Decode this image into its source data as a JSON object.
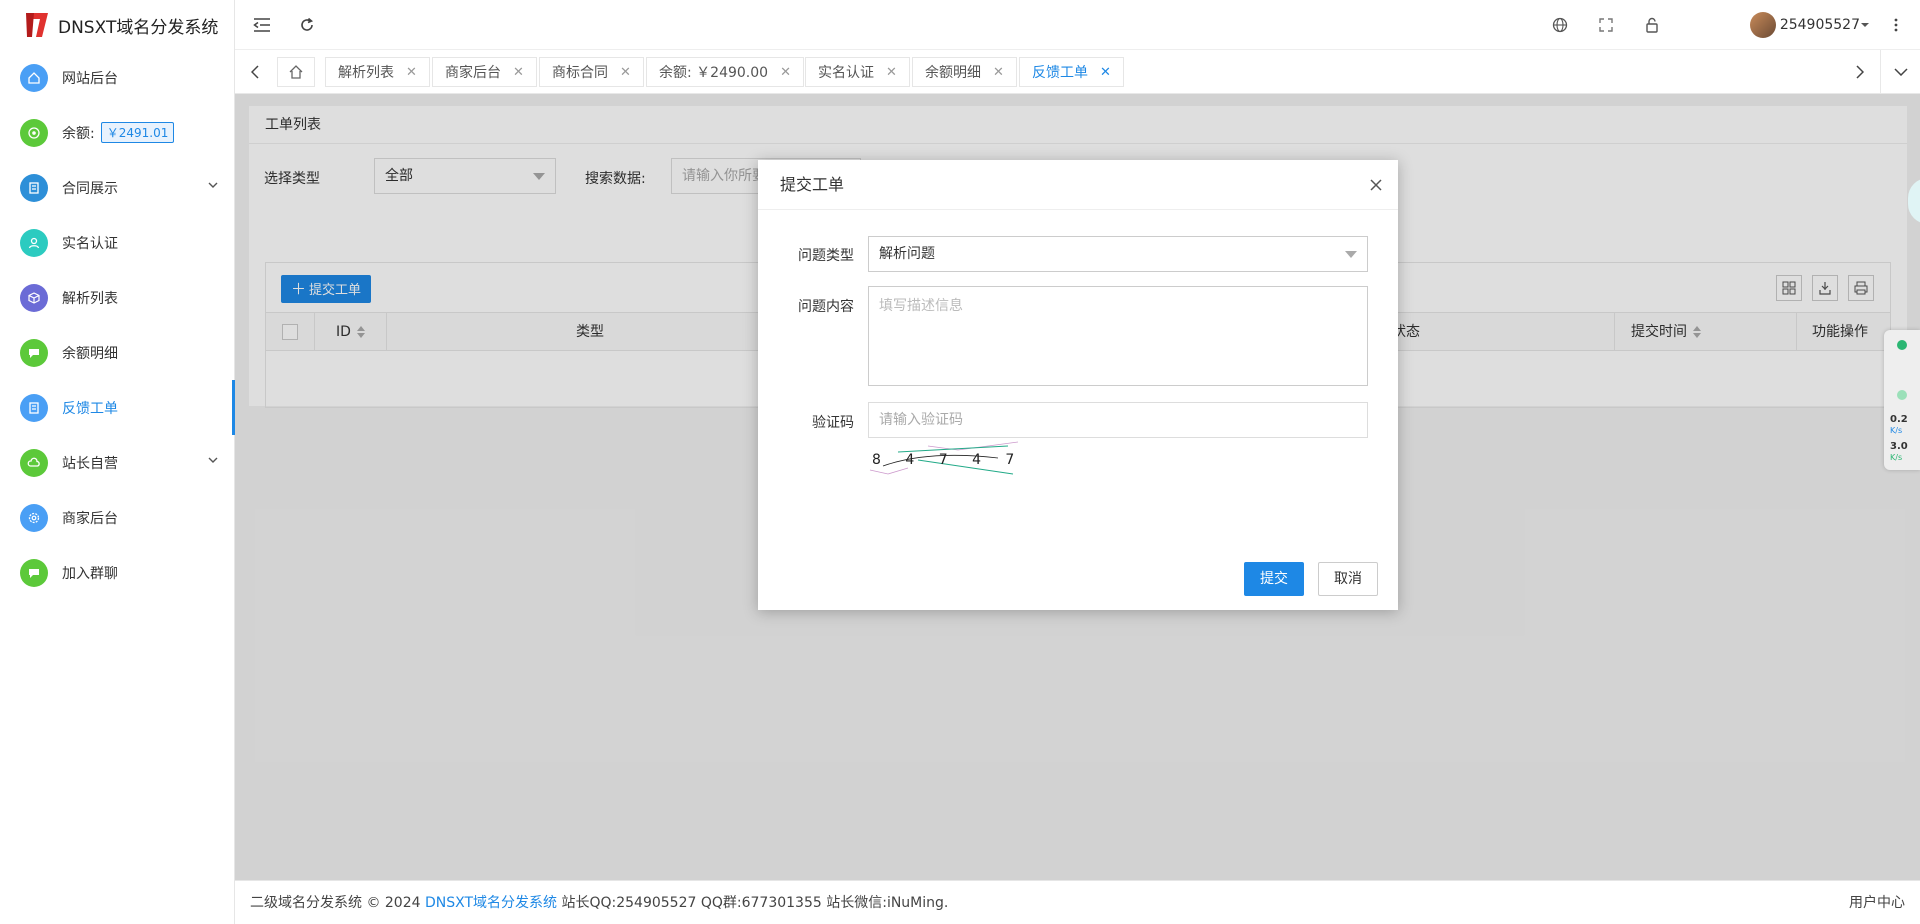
{
  "app": {
    "title": "DNSXT域名分发系统"
  },
  "sidebar": {
    "items": [
      {
        "label": "网站后台",
        "icon": "home-icon",
        "color": "#4a9ff5"
      },
      {
        "label": "余额:",
        "icon": "coin-icon",
        "color": "#5cc93a",
        "badge": "￥2491.01"
      },
      {
        "label": "合同展示",
        "icon": "contract-icon",
        "color": "#2d8fd8"
      },
      {
        "label": "实名认证",
        "icon": "user-verify-icon",
        "color": "#2ccbc0"
      },
      {
        "label": "解析列表",
        "icon": "cube-icon",
        "color": "#6b6bd6"
      },
      {
        "label": "余额明细",
        "icon": "chat-icon",
        "color": "#5cc93a"
      },
      {
        "label": "反馈工单",
        "icon": "document-icon",
        "color": "#4a9ff5"
      },
      {
        "label": "站长自营",
        "icon": "cloud-icon",
        "color": "#5cc93a"
      },
      {
        "label": "商家后台",
        "icon": "gear-icon",
        "color": "#4a9ff5"
      },
      {
        "label": "加入群聊",
        "icon": "chat-icon",
        "color": "#5cc93a"
      }
    ]
  },
  "header": {
    "username": "254905527"
  },
  "tabs": [
    {
      "label": "解析列表"
    },
    {
      "label": "商家后台"
    },
    {
      "label": "商标合同"
    },
    {
      "label": "余额: ￥2490.00"
    },
    {
      "label": "实名认证"
    },
    {
      "label": "余额明细"
    },
    {
      "label": "反馈工单"
    }
  ],
  "page": {
    "title": "工单列表",
    "filter": {
      "type_label": "选择类型",
      "type_value": "全部",
      "search_label": "搜索数据:",
      "search_placeholder": "请输入你所要"
    },
    "toolbar": {
      "submit_label": "提交工单"
    },
    "table": {
      "headers": [
        "ID",
        "类型",
        "状态",
        "提交时间",
        "功能操作"
      ]
    }
  },
  "modal": {
    "title": "提交工单",
    "type_label": "问题类型",
    "type_value": "解析问题",
    "content_label": "问题内容",
    "content_placeholder": "填写描述信息",
    "captcha_label": "验证码",
    "captcha_placeholder": "请输入验证码",
    "captcha_text": "8 4 7 4 7",
    "submit_label": "提交",
    "cancel_label": "取消"
  },
  "footer": {
    "prefix": "二级域名分发系统 © 2024",
    "link": "DNSXT域名分发系统",
    "suffix": "站长QQ:254905527 QQ群:677301355 站长微信:iNuMing.",
    "right": "用户中心"
  },
  "net": {
    "up": "0.2",
    "up_unit": "K/s",
    "down": "3.0",
    "down_unit": "K/s"
  }
}
